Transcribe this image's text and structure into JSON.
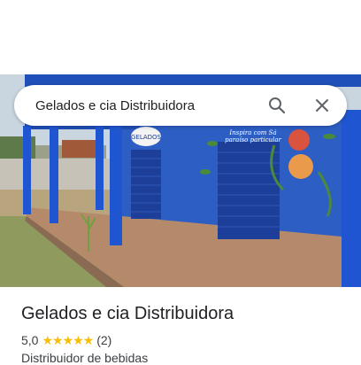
{
  "search": {
    "query": "Gelados e cia Distribuidora",
    "search_icon": "search-icon",
    "close_icon": "close-icon"
  },
  "photo": {
    "sign_text": "GELADOS",
    "mural_line1": "Inspira com Sá",
    "mural_line2": "paraíso particular"
  },
  "place": {
    "name": "Gelados e cia Distribuidora",
    "rating": "5,0",
    "stars": "★★★★★",
    "review_count": "(2)",
    "category": "Distribuidor de bebidas"
  },
  "colors": {
    "star": "#fbbc04",
    "text_primary": "#202124",
    "text_secondary": "#3c4043"
  }
}
